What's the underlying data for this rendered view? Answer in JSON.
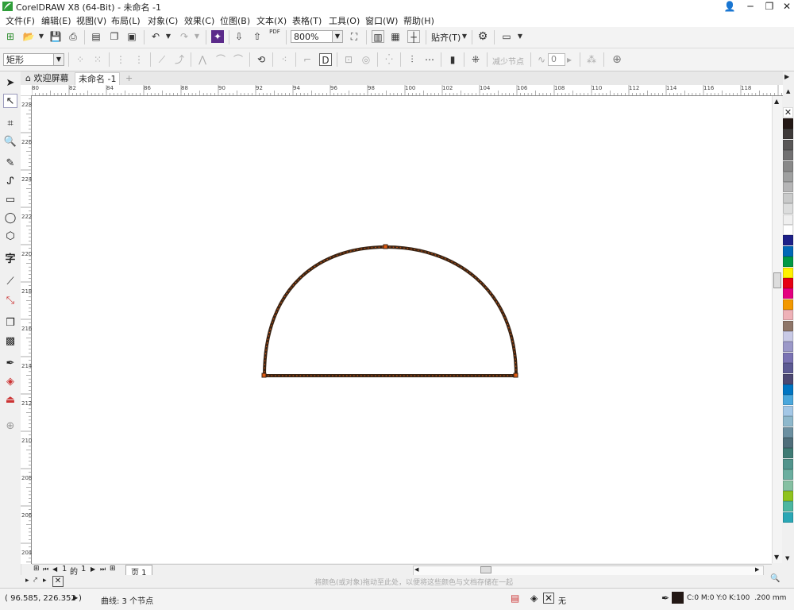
{
  "app": {
    "title": "CorelDRAW X8 (64-Bit) - 未命名 -1",
    "window_buttons": [
      "👤",
      "─",
      "❐",
      "✕"
    ]
  },
  "menu": [
    "文件(F)",
    "编辑(E)",
    "视图(V)",
    "布局(L)",
    "对象(C)",
    "效果(C)",
    "位图(B)",
    "文本(X)",
    "表格(T)",
    "工具(O)",
    "窗口(W)",
    "帮助(H)"
  ],
  "toolbar": {
    "zoom_value": "800%",
    "snap_label": "贴齐(T)",
    "pdf_label": "PDF"
  },
  "property_bar": {
    "shape_type": "矩形",
    "reduce_nodes_label": "减少节点",
    "smoothing_value": "0"
  },
  "tabs": {
    "welcome": "欢迎屏幕",
    "document": "未命名 -1"
  },
  "rulers": {
    "horizontal": [
      "80",
      "82",
      "84",
      "86",
      "88",
      "90",
      "92",
      "94",
      "96",
      "98",
      "100",
      "102",
      "104",
      "106",
      "108",
      "110",
      "112",
      "114",
      "116",
      "118"
    ],
    "vertical": [
      "228",
      "226",
      "224",
      "222",
      "220",
      "218",
      "216",
      "214",
      "212",
      "210",
      "208",
      "206",
      "204"
    ]
  },
  "page_nav": {
    "current": "1",
    "of_label": "的",
    "total": "1",
    "page_tab": "页 1"
  },
  "hint_text": "将颜色(或对象)拖动至此处，以便将这些颜色与文档存储在一起",
  "status": {
    "coords": "( 96.585, 226.352 )",
    "object_info": "曲线: 3 个节点",
    "fill_label": "无",
    "outline_color": "C:0 M:0 Y:0 K:100",
    "outline_width": ".200 mm"
  },
  "palette_colors": [
    "#231815",
    "#3e3a39",
    "#595757",
    "#717071",
    "#898989",
    "#9fa0a0",
    "#b5b5b6",
    "#c9caca",
    "#dcdddd",
    "#efefef",
    "#ffffff",
    "#1d2088",
    "#0068b7",
    "#009944",
    "#fff100",
    "#e60012",
    "#e4007f",
    "#f39800",
    "#eeb1b7",
    "#8e7669",
    "#c8c9e5",
    "#9b98c8",
    "#7a72b3",
    "#5c5a93",
    "#4c4872",
    "#0075c2",
    "#4aa7dc",
    "#a3c7e6",
    "#8eb8cc",
    "#6b8fa0",
    "#4f6e7a",
    "#3f7b74",
    "#52948c",
    "#6bae9f",
    "#86c0a2",
    "#8fc31f",
    "#4cb6a0",
    "#2aa7b5"
  ],
  "accent_outline": "#231815",
  "shape_outline": "#3a2414",
  "node_color": "#e05a10"
}
